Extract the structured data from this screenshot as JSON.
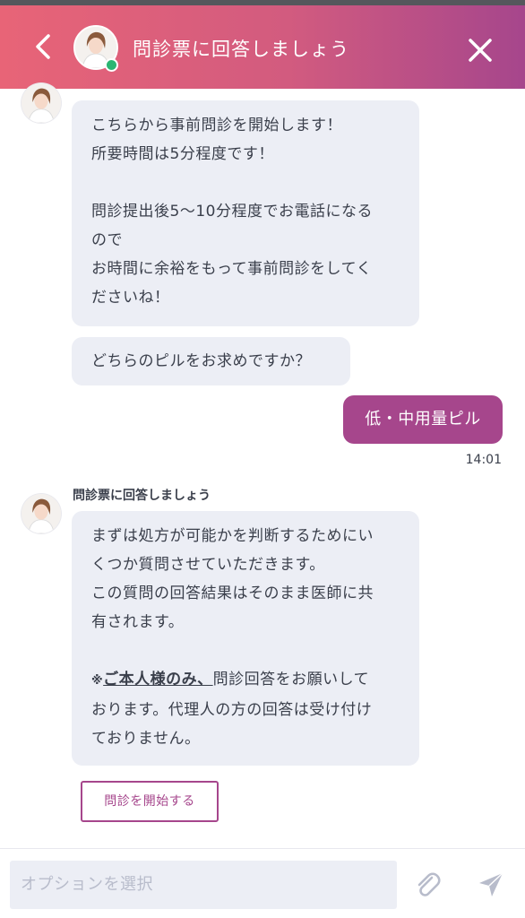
{
  "header": {
    "title": "問診票に回答しましょう",
    "back_icon": "chevron-left-icon",
    "close_icon": "close-icon"
  },
  "messages": [
    {
      "type": "received",
      "lines": [
        "こちらから事前問診を開始します！",
        "所要時間は5分程度です！",
        "",
        "問診提出後5〜10分程度でお電話になる",
        "ので",
        "お時間に余裕をもって事前問診をしてく",
        "ださいね！"
      ]
    },
    {
      "type": "received",
      "lines": [
        "どちらのピルをお求めですか？"
      ]
    },
    {
      "type": "sent",
      "text": "低・中用量ピル",
      "time": "14:01"
    },
    {
      "type": "received",
      "sender": "問診票に回答しましょう",
      "lines": [
        "まずは処方が可能かを判断するためにい",
        "くつか質問させていただきます。",
        "この質問の回答結果はそのまま医師に共",
        "有されます。",
        ""
      ],
      "notice": {
        "mark": "※",
        "emphasis": "ご本人様のみ、",
        "rest_first_line": "問診回答をお願いして",
        "rest_lines": [
          "おります。代理人の方の回答は受け付け",
          "ておりません。"
        ]
      },
      "action_button": "問診を開始する"
    }
  ],
  "composer": {
    "placeholder": "オプションを選択",
    "attach_icon": "paperclip-icon",
    "send_icon": "send-icon"
  },
  "colors": {
    "header_gradient_start": "#e86477",
    "header_gradient_end": "#a6468c",
    "accent": "#a6468c",
    "bubble_bg": "#eceef5",
    "online_dot": "#2bb673"
  }
}
